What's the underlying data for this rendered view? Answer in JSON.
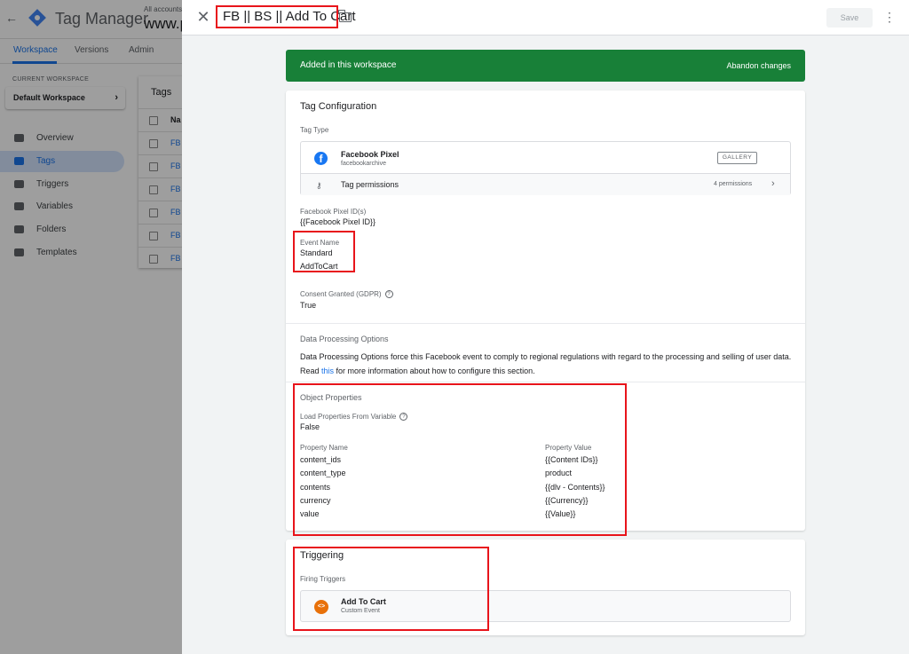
{
  "app": {
    "back_glyph": "←",
    "title": "Tag Manager",
    "accounts_label": "All accounts",
    "site_name": "www.p",
    "tabs": [
      "Workspace",
      "Versions",
      "Admin"
    ],
    "current_workspace_label": "CURRENT WORKSPACE",
    "workspace_name": "Default Workspace",
    "workspace_chevron": "›",
    "nav": [
      {
        "label": "Overview",
        "icon": "overview-icon"
      },
      {
        "label": "Tags",
        "icon": "tag-icon"
      },
      {
        "label": "Triggers",
        "icon": "trigger-icon"
      },
      {
        "label": "Variables",
        "icon": "variable-icon"
      },
      {
        "label": "Folders",
        "icon": "folder-icon"
      },
      {
        "label": "Templates",
        "icon": "template-icon"
      }
    ],
    "tags_card_title": "Tags",
    "tags_rows": [
      "Na",
      "FB",
      "FB",
      "FB",
      "FB",
      "FB",
      "FB"
    ]
  },
  "panel": {
    "close_glyph": "✕",
    "tag_name": "FB || BS || Add To Cart",
    "save_label": "Save",
    "more_glyph": "⋮",
    "banner_text": "Added in this workspace",
    "banner_action": "Abandon changes",
    "config": {
      "title": "Tag Configuration",
      "tag_type_label": "Tag Type",
      "tag_type_icon_glyph": "f",
      "tag_type_name": "Facebook Pixel",
      "tag_type_sub": "facebookarchive",
      "gallery_label": "GALLERY",
      "key_glyph": "⚷",
      "permissions_label": "Tag permissions",
      "permissions_count": "4 permissions",
      "permissions_chevron": "›",
      "pixel_id_label": "Facebook Pixel ID(s)",
      "pixel_id_value": "{{Facebook Pixel ID}}",
      "event_name_label": "Event Name",
      "event_name_type": "Standard",
      "event_name_value": "AddToCart",
      "consent_label": "Consent Granted (GDPR)",
      "help_glyph": "?",
      "consent_value": "True",
      "dpo_title": "Data Processing Options",
      "dpo_text_before": "Data Processing Options force this Facebook event to comply to regional regulations with regard to the processing and selling of user data. Read ",
      "dpo_link": "this",
      "dpo_text_after": " for more information about how to configure this section.",
      "object_properties_title": "Object Properties",
      "load_from_variable_label": "Load Properties From Variable",
      "load_from_variable_value": "False",
      "property_name_header": "Property Name",
      "property_value_header": "Property Value",
      "properties": [
        {
          "name": "content_ids",
          "value": "{{Content IDs}}"
        },
        {
          "name": "content_type",
          "value": "product"
        },
        {
          "name": "contents",
          "value": "{{dlv - Contents}}"
        },
        {
          "name": "currency",
          "value": "{{Currency}}"
        },
        {
          "name": "value",
          "value": "{{Value}}"
        }
      ]
    },
    "triggering": {
      "title": "Triggering",
      "firing_label": "Firing Triggers",
      "trigger_icon_glyph": "<>",
      "trigger_name": "Add To Cart",
      "trigger_sub": "Custom Event"
    }
  }
}
